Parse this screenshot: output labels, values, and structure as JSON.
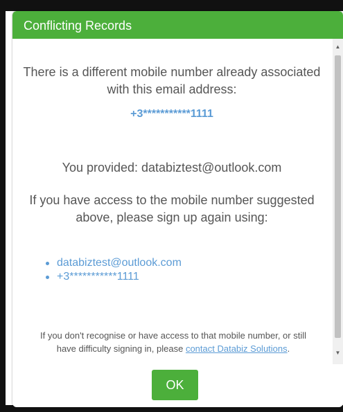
{
  "dialog": {
    "title": "Conflicting Records",
    "message_line1": "There is a different mobile number already associated with this email address:",
    "masked_mobile": "+3***********1111",
    "provided": "You provided: databiztest@outlook.com",
    "instructions": "If you have access to the mobile number suggested above, please sign up again using:",
    "options": [
      "databiztest@outlook.com",
      "+3***********1111"
    ],
    "note_before_link": "If you don't recognise or have access to that mobile number, or still have difficulty signing in, please ",
    "note_link": "contact Databiz Solutions",
    "note_after_link": ".",
    "ok_label": "OK",
    "scroll_up_icon": "▲",
    "scroll_down_icon": "▼"
  },
  "colors": {
    "header_green": "#4caf3b",
    "button_green": "#4caf3b",
    "link_blue": "#5b9bd5",
    "text_gray": "#555555"
  },
  "icons": {
    "scroll_up": "scroll-up-arrow-icon",
    "scroll_down": "scroll-down-arrow-icon",
    "bullet": "bullet-dot-icon"
  }
}
